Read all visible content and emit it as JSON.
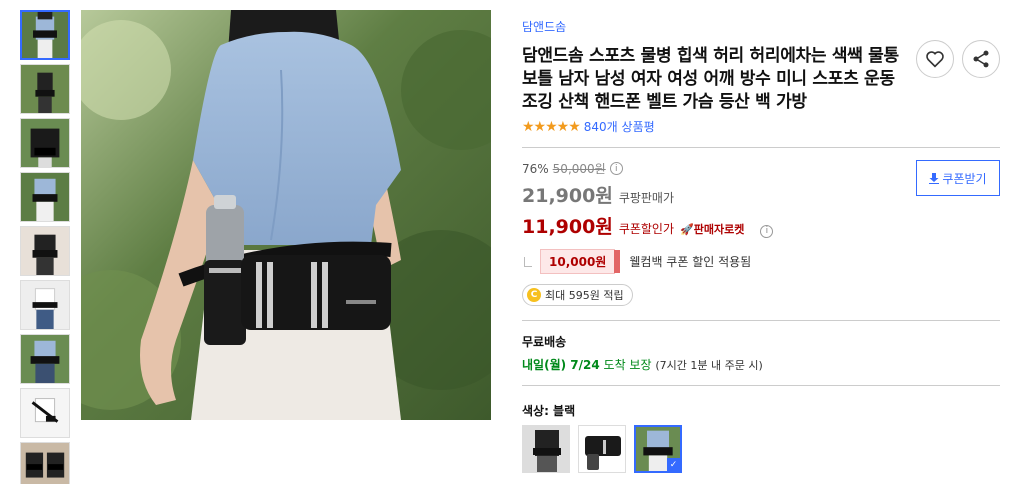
{
  "thumbnails": [
    {
      "name": "thumb-1",
      "active": true
    },
    {
      "name": "thumb-2",
      "active": false
    },
    {
      "name": "thumb-3",
      "active": false
    },
    {
      "name": "thumb-4",
      "active": false
    },
    {
      "name": "thumb-5",
      "active": false
    },
    {
      "name": "thumb-6",
      "active": false
    },
    {
      "name": "thumb-7",
      "active": false
    },
    {
      "name": "thumb-8",
      "active": false
    },
    {
      "name": "thumb-9",
      "active": false
    }
  ],
  "product": {
    "brand": "담앤드솜",
    "title": "담앤드솜 스포츠 물병 힙색 허리 허리에차는 색쌕 물통 보틀 남자 남성 여자 여성 어깨 방수 미니 스포츠 운동 조깅 산책 핸드폰 벨트 가슴 등산 백 가방",
    "stars": "★★★★★",
    "rating": 4.5,
    "review_count": "840개 상품평"
  },
  "price": {
    "discount_rate": "76%",
    "original_price": "50,000원",
    "sale_price": "21,900원",
    "sale_label": "쿠팡판매가",
    "coupon_price": "11,900원",
    "coupon_label": "쿠폰할인가",
    "seller_rocket": "판매자로켓",
    "coupon_button": "쿠폰받기",
    "welcome_coupon_amount": "10,000원",
    "welcome_coupon_text": "웰컴백 쿠폰 할인 적용됨",
    "points_text": "최대 595원 적립",
    "coin_glyph": "C"
  },
  "shipping": {
    "title": "무료배송",
    "arrival": "내일(월) 7/24",
    "arrival_tail": "도착 보장",
    "note": "(7시간 1분 내 주문 시)"
  },
  "options": {
    "color_label": "색상: 블랙",
    "swatches": [
      {
        "name": "swatch-1",
        "selected": false
      },
      {
        "name": "swatch-2",
        "selected": false
      },
      {
        "name": "swatch-3",
        "selected": true
      }
    ]
  },
  "icons": {
    "wishlist": "heart-icon",
    "share": "share-icon",
    "download": "download-icon",
    "info": "info-icon",
    "rocket": "rocket-icon",
    "check": "check-icon"
  },
  "colors": {
    "accent": "#346aff",
    "price_red": "#ae0000",
    "ship_green": "#00891a",
    "star": "#f29b1e"
  }
}
